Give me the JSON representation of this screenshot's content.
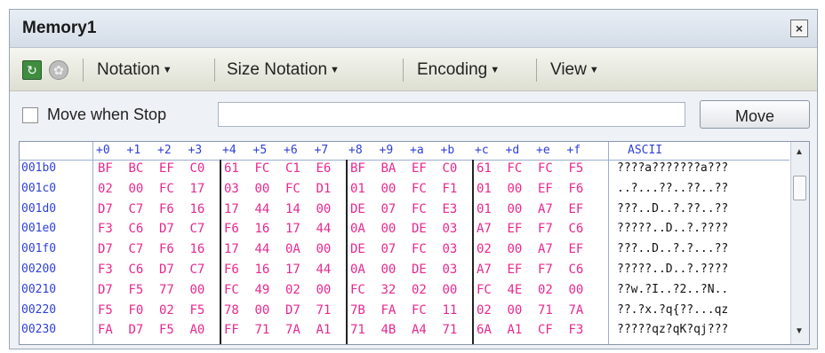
{
  "window": {
    "title": "Memory1",
    "close_icon": "close-icon"
  },
  "toolbar": {
    "refresh_icon": "refresh-icon",
    "gear_icon": "gear-icon",
    "menus": [
      "Notation",
      "Size Notation",
      "Encoding",
      "View"
    ]
  },
  "options": {
    "move_when_stop_label": "Move when Stop",
    "move_when_stop_checked": false,
    "address_value": "",
    "move_button": "Move"
  },
  "memory": {
    "offset_headers": [
      "+0",
      "+1",
      "+2",
      "+3",
      "+4",
      "+5",
      "+6",
      "+7",
      "+8",
      "+9",
      "+a",
      "+b",
      "+c",
      "+d",
      "+e",
      "+f"
    ],
    "ascii_header": "ASCII",
    "rows": [
      {
        "address": "001b0",
        "bytes": [
          "BF",
          "BC",
          "EF",
          "C0",
          "61",
          "FC",
          "C1",
          "E6",
          "BF",
          "BA",
          "EF",
          "C0",
          "61",
          "FC",
          "FC",
          "F5"
        ],
        "ascii": "????a???????a???"
      },
      {
        "address": "001c0",
        "bytes": [
          "02",
          "00",
          "FC",
          "17",
          "03",
          "00",
          "FC",
          "D1",
          "01",
          "00",
          "FC",
          "F1",
          "01",
          "00",
          "EF",
          "F6"
        ],
        "ascii": "..?...??..??..??"
      },
      {
        "address": "001d0",
        "bytes": [
          "D7",
          "C7",
          "F6",
          "16",
          "17",
          "44",
          "14",
          "00",
          "DE",
          "07",
          "FC",
          "E3",
          "01",
          "00",
          "A7",
          "EF"
        ],
        "ascii": "???..D..?.??..??"
      },
      {
        "address": "001e0",
        "bytes": [
          "F3",
          "C6",
          "D7",
          "C7",
          "F6",
          "16",
          "17",
          "44",
          "0A",
          "00",
          "DE",
          "03",
          "A7",
          "EF",
          "F7",
          "C6"
        ],
        "ascii": "?????..D..?.????"
      },
      {
        "address": "001f0",
        "bytes": [
          "D7",
          "C7",
          "F6",
          "16",
          "17",
          "44",
          "0A",
          "00",
          "DE",
          "07",
          "FC",
          "03",
          "02",
          "00",
          "A7",
          "EF"
        ],
        "ascii": "???..D..?.?...??"
      },
      {
        "address": "00200",
        "bytes": [
          "F3",
          "C6",
          "D7",
          "C7",
          "F6",
          "16",
          "17",
          "44",
          "0A",
          "00",
          "DE",
          "03",
          "A7",
          "EF",
          "F7",
          "C6"
        ],
        "ascii": "?????..D..?.????"
      },
      {
        "address": "00210",
        "bytes": [
          "D7",
          "F5",
          "77",
          "00",
          "FC",
          "49",
          "02",
          "00",
          "FC",
          "32",
          "02",
          "00",
          "FC",
          "4E",
          "02",
          "00"
        ],
        "ascii": "??w.?I..?2..?N.."
      },
      {
        "address": "00220",
        "bytes": [
          "F5",
          "F0",
          "02",
          "F5",
          "78",
          "00",
          "D7",
          "71",
          "7B",
          "FA",
          "FC",
          "11",
          "02",
          "00",
          "71",
          "7A"
        ],
        "ascii": "??.?x.?q{??...qz"
      },
      {
        "address": "00230",
        "bytes": [
          "FA",
          "D7",
          "F5",
          "A0",
          "FF",
          "71",
          "7A",
          "A1",
          "71",
          "4B",
          "A4",
          "71",
          "6A",
          "A1",
          "CF",
          "F3"
        ],
        "ascii": "?????qz?qK?qj???"
      }
    ]
  }
}
